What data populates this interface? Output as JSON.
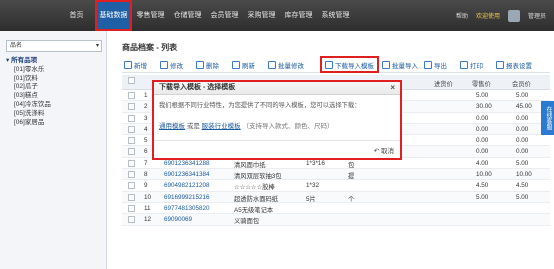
{
  "nav": {
    "items": [
      "首页",
      "基础数据",
      "零售管理",
      "仓储管理",
      "会员管理",
      "采购管理",
      "库存管理",
      "系统管理"
    ],
    "active_index": 1,
    "right": {
      "help": "帮助",
      "welcome": "欢迎使用",
      "user": "管理员"
    }
  },
  "sidebar": {
    "select_value": "品名",
    "root": "所有品项",
    "nodes": [
      "[01]零水乐",
      "[01]饮料",
      "[02]瓜子",
      "[03]糕点",
      "[04]冷冻饮品",
      "[05]洗涤料",
      "[06]家居品"
    ]
  },
  "main": {
    "title": "商品档案 - 列表",
    "toolbar": {
      "new": "新增",
      "edit": "修改",
      "delete": "删除",
      "refresh": "刷新",
      "batch_modify": "批量修改",
      "download_template": "下载导入模板",
      "batch_import": "批量导入",
      "export": "导出",
      "print": "打印",
      "report_setting": "报表设置"
    },
    "columns": {
      "cost_price": "进货价",
      "retail_price": "零售价",
      "member_price": "会员价"
    },
    "side_tab": "在线客服",
    "rows": [
      {
        "no": "1",
        "code": "",
        "name": "",
        "spec": "",
        "unit": "",
        "cost": "",
        "retail": "5.00",
        "member": "5.00"
      },
      {
        "no": "2",
        "code": "",
        "name": "",
        "spec": "",
        "unit": "",
        "cost": "",
        "retail": "30.00",
        "member": "45.00"
      },
      {
        "no": "3",
        "code": "",
        "name": "",
        "spec": "",
        "unit": "",
        "cost": "",
        "retail": "0.00",
        "member": "0.00"
      },
      {
        "no": "4",
        "code": "",
        "name": "",
        "spec": "",
        "unit": "",
        "cost": "",
        "retail": "0.00",
        "member": "0.00"
      },
      {
        "no": "5",
        "code": "",
        "name": "",
        "spec": "",
        "unit": "",
        "cost": "",
        "retail": "0.00",
        "member": "0.00"
      },
      {
        "no": "6",
        "code": "",
        "name": "",
        "spec": "",
        "unit": "",
        "cost": "",
        "retail": "0.00",
        "member": "0.00"
      },
      {
        "no": "7",
        "code": "6901236341288",
        "name": "清风面巾纸",
        "spec": "1*3*16",
        "unit": "包",
        "cost": "",
        "retail": "4.00",
        "member": "5.00"
      },
      {
        "no": "8",
        "code": "6901236341384",
        "name": "清风双层软抽3包",
        "spec": "",
        "unit": "提",
        "cost": "",
        "retail": "10.00",
        "member": "10.00"
      },
      {
        "no": "9",
        "code": "6904982121208",
        "name": "☆☆☆☆☆胶棒",
        "spec": "1*32",
        "unit": "",
        "cost": "",
        "retail": "4.50",
        "member": "4.50"
      },
      {
        "no": "10",
        "code": "6916999215216",
        "name": "超透防水面码纸",
        "spec": "5片",
        "unit": "个",
        "cost": "",
        "retail": "5.00",
        "member": "5.00"
      },
      {
        "no": "11",
        "code": "6977481305820",
        "name": "A5无级笔记本",
        "spec": "",
        "unit": "",
        "cost": "",
        "retail": "",
        "member": ""
      },
      {
        "no": "12",
        "code": "69090069",
        "name": "义骑面包",
        "spec": "",
        "unit": "",
        "cost": "",
        "retail": "",
        "member": ""
      }
    ]
  },
  "modal": {
    "title": "下载导入模板 - 选择模板",
    "description": "我们根据不同行业特性，为您提供了不同的导入模板，您可以选择下载：",
    "link_general": "通用模板",
    "or_text": "或是",
    "link_apparel": "服装行业模板",
    "hint": "（支持导入款式、颜色、尺码）",
    "cancel": "取消",
    "close": "×"
  }
}
